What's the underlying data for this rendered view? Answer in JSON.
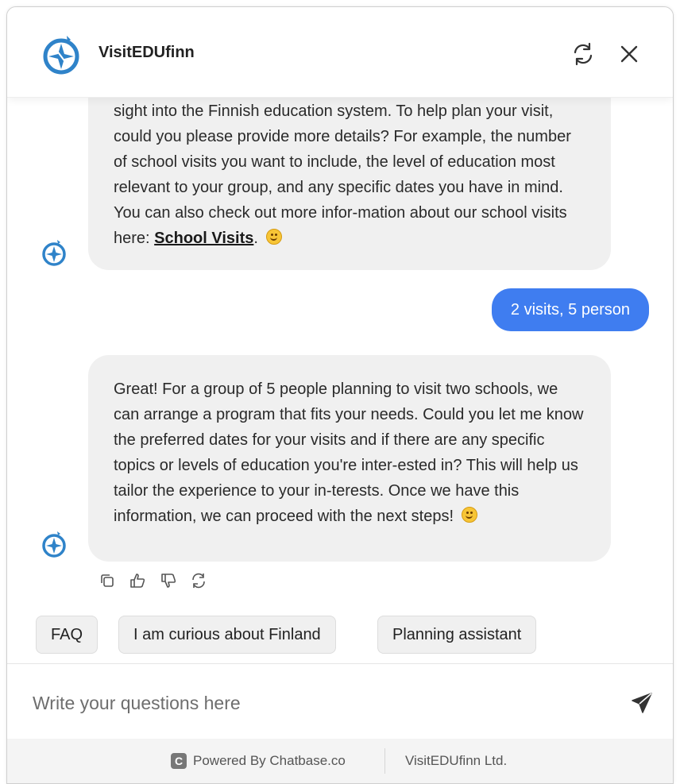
{
  "header": {
    "title": "VisitEDUfinn",
    "refresh_icon": "refresh-icon",
    "close_icon": "close-icon"
  },
  "messages": {
    "first_bot_text": "sight into the Finnish education system. To help plan your visit, could you please provide more details? For example, the number of school visits you want to include, the level of education most relevant to your group, and any specific dates you have in mind. You can also check out more infor-mation about our school visits here:",
    "first_bot_link": "School Visits",
    "first_bot_suffix": ".",
    "user_message": "2 visits, 5 person",
    "second_bot_text": "Great! For a group of 5 people planning to visit two schools, we can arrange a program that fits your needs. Could you let me know the preferred dates for your visits and if there are any specific topics or levels of education you're inter-ested in? This will help us tailor the experience to your in-terests. Once we have this information, we can proceed with the next steps!"
  },
  "suggestions": [
    {
      "label": "FAQ"
    },
    {
      "label": "I am curious about Finland"
    },
    {
      "label": "Planning assistant"
    }
  ],
  "input": {
    "placeholder": "Write your questions here"
  },
  "footer": {
    "powered_by": "Powered By Chatbase.co",
    "company": "VisitEDUfinn Ltd.",
    "brand_icon_letter": "C"
  },
  "colors": {
    "user_bubble": "#3f7df0",
    "bot_bubble": "#f0f0f0",
    "logo_blue": "#2f83c9"
  }
}
